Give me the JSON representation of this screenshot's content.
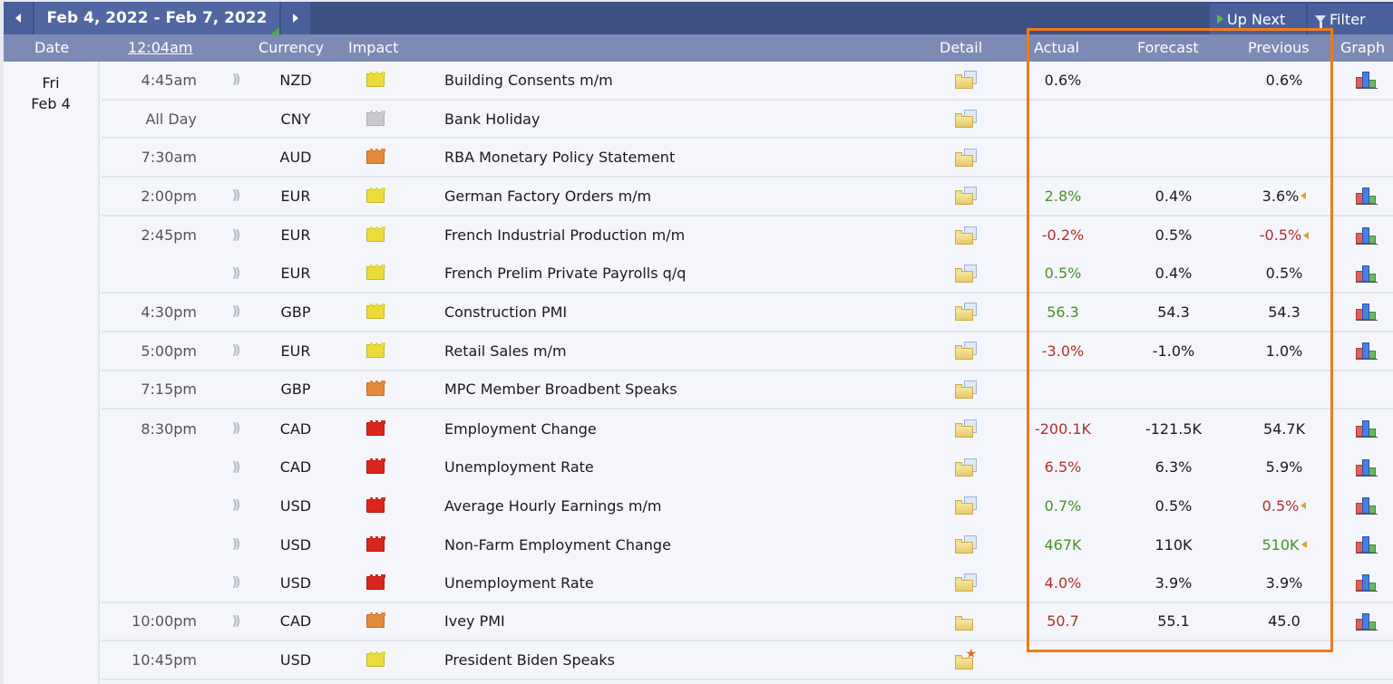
{
  "toolbar": {
    "date_range": "Feb 4, 2022 - Feb 7, 2022",
    "up_next_label": "Up Next",
    "filter_label": "Filter",
    "prev_icon": "triangle-left",
    "next_icon": "triangle-right"
  },
  "columns": {
    "date": "Date",
    "time": "12:04am",
    "currency": "Currency",
    "impact": "Impact",
    "detail": "Detail",
    "actual": "Actual",
    "forecast": "Forecast",
    "previous": "Previous",
    "graph": "Graph"
  },
  "day": {
    "weekday": "Fri",
    "date": "Feb 4"
  },
  "colors": {
    "better": "#4a8f2e",
    "worse": "#b0302b",
    "impact_high": "#d9261c",
    "impact_medium": "#e28a3a",
    "impact_low": "#ecdc3a",
    "impact_holiday": "#c8cacd",
    "highlight_box": "#f07a1e"
  },
  "events": [
    {
      "time": "4:45am",
      "sound": true,
      "currency": "NZD",
      "impact": "yellow",
      "event": "Building Consents m/m",
      "detail": "folder",
      "actual": "0.6%",
      "actual_tone": "neutral",
      "forecast": "",
      "previous": "0.6%",
      "previous_tone": "neutral",
      "revised": false,
      "graph": true
    },
    {
      "time": "All Day",
      "sound": false,
      "currency": "CNY",
      "impact": "gray",
      "event": "Bank Holiday",
      "detail": "folder",
      "actual": "",
      "actual_tone": "neutral",
      "forecast": "",
      "previous": "",
      "previous_tone": "neutral",
      "revised": false,
      "graph": false
    },
    {
      "time": "7:30am",
      "sound": false,
      "currency": "AUD",
      "impact": "orange",
      "event": "RBA Monetary Policy Statement",
      "detail": "folder",
      "actual": "",
      "actual_tone": "neutral",
      "forecast": "",
      "previous": "",
      "previous_tone": "neutral",
      "revised": false,
      "graph": false
    },
    {
      "time": "2:00pm",
      "sound": true,
      "currency": "EUR",
      "impact": "yellow",
      "event": "German Factory Orders m/m",
      "detail": "folder",
      "actual": "2.8%",
      "actual_tone": "good",
      "forecast": "0.4%",
      "previous": "3.6%",
      "previous_tone": "neutral",
      "revised": true,
      "graph": true
    },
    {
      "time": "2:45pm",
      "sound": true,
      "currency": "EUR",
      "impact": "yellow",
      "event": "French Industrial Production m/m",
      "detail": "folder",
      "actual": "-0.2%",
      "actual_tone": "bad",
      "forecast": "0.5%",
      "previous": "-0.5%",
      "previous_tone": "bad",
      "revised": true,
      "graph": true
    },
    {
      "time": "",
      "sound": true,
      "currency": "EUR",
      "impact": "yellow",
      "event": "French Prelim Private Payrolls q/q",
      "detail": "folder",
      "actual": "0.5%",
      "actual_tone": "good",
      "forecast": "0.4%",
      "previous": "0.5%",
      "previous_tone": "neutral",
      "revised": false,
      "graph": true
    },
    {
      "time": "4:30pm",
      "sound": true,
      "currency": "GBP",
      "impact": "yellow",
      "event": "Construction PMI",
      "detail": "folder",
      "actual": "56.3",
      "actual_tone": "good",
      "forecast": "54.3",
      "previous": "54.3",
      "previous_tone": "neutral",
      "revised": false,
      "graph": true
    },
    {
      "time": "5:00pm",
      "sound": true,
      "currency": "EUR",
      "impact": "yellow",
      "event": "Retail Sales m/m",
      "detail": "folder",
      "actual": "-3.0%",
      "actual_tone": "bad",
      "forecast": "-1.0%",
      "previous": "1.0%",
      "previous_tone": "neutral",
      "revised": false,
      "graph": true
    },
    {
      "time": "7:15pm",
      "sound": false,
      "currency": "GBP",
      "impact": "orange",
      "event": "MPC Member Broadbent Speaks",
      "detail": "folder",
      "actual": "",
      "actual_tone": "neutral",
      "forecast": "",
      "previous": "",
      "previous_tone": "neutral",
      "revised": false,
      "graph": false
    },
    {
      "time": "8:30pm",
      "sound": true,
      "currency": "CAD",
      "impact": "red",
      "event": "Employment Change",
      "detail": "folder",
      "actual": "-200.1K",
      "actual_tone": "bad",
      "forecast": "-121.5K",
      "previous": "54.7K",
      "previous_tone": "neutral",
      "revised": false,
      "graph": true
    },
    {
      "time": "",
      "sound": true,
      "currency": "CAD",
      "impact": "red",
      "event": "Unemployment Rate",
      "detail": "folder",
      "actual": "6.5%",
      "actual_tone": "bad",
      "forecast": "6.3%",
      "previous": "5.9%",
      "previous_tone": "neutral",
      "revised": false,
      "graph": true
    },
    {
      "time": "",
      "sound": true,
      "currency": "USD",
      "impact": "red",
      "event": "Average Hourly Earnings m/m",
      "detail": "folder",
      "actual": "0.7%",
      "actual_tone": "good",
      "forecast": "0.5%",
      "previous": "0.5%",
      "previous_tone": "bad",
      "revised": true,
      "graph": true
    },
    {
      "time": "",
      "sound": true,
      "currency": "USD",
      "impact": "red",
      "event": "Non-Farm Employment Change",
      "detail": "folder",
      "actual": "467K",
      "actual_tone": "good",
      "forecast": "110K",
      "previous": "510K",
      "previous_tone": "good",
      "revised": true,
      "graph": true
    },
    {
      "time": "",
      "sound": true,
      "currency": "USD",
      "impact": "red",
      "event": "Unemployment Rate",
      "detail": "folder",
      "actual": "4.0%",
      "actual_tone": "bad",
      "forecast": "3.9%",
      "previous": "3.9%",
      "previous_tone": "neutral",
      "revised": false,
      "graph": true
    },
    {
      "time": "10:00pm",
      "sound": true,
      "currency": "CAD",
      "impact": "orange",
      "event": "Ivey PMI",
      "detail": "folder-plain",
      "actual": "50.7",
      "actual_tone": "bad",
      "forecast": "55.1",
      "previous": "45.0",
      "previous_tone": "neutral",
      "revised": false,
      "graph": true
    },
    {
      "time": "10:45pm",
      "sound": false,
      "currency": "USD",
      "impact": "yellow",
      "event": "President Biden Speaks",
      "detail": "folder-star",
      "actual": "",
      "actual_tone": "neutral",
      "forecast": "",
      "previous": "",
      "previous_tone": "neutral",
      "revised": false,
      "graph": false
    }
  ],
  "row_separators_after": [
    0,
    1,
    2,
    3,
    5,
    6,
    7,
    8,
    13,
    14,
    15
  ]
}
